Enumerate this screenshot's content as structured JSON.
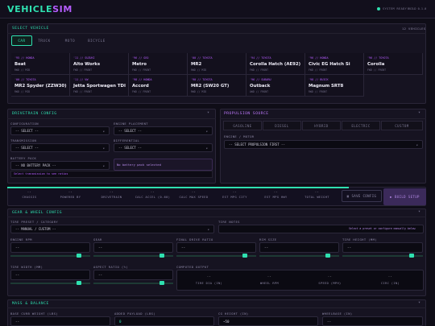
{
  "app": {
    "logo_a": "VEHICLE",
    "logo_b": "SIM",
    "status": "SYSTEM READY",
    "build": "BUILD 0.1.0"
  },
  "select_vehicle": {
    "title": "SELECT VEHICLE",
    "count": "12 VEHICLES",
    "tabs": [
      "CAR",
      "TRUCK",
      "MOTO",
      "BICYCLE"
    ],
    "active_tab": "CAR",
    "vehicles": [
      {
        "tag": "'95 // HONDA",
        "name": "Beat",
        "spec": "RWD // MID"
      },
      {
        "tag": "'11 // SUZUKI",
        "name": "Alto Works",
        "spec": "FWD // FRONT"
      },
      {
        "tag": "'96 // GEO",
        "name": "Metro",
        "spec": "FWD // FRONT"
      },
      {
        "tag": "'00 // TOYOTA",
        "name": "MR2",
        "spec": "RWD // MID"
      },
      {
        "tag": "'94 // TOYOTA",
        "name": "Corolla Hatch (AE92)",
        "spec": "FWD // FRONT"
      },
      {
        "tag": "'96 // HONDA",
        "name": "Civic EG Hatch Si",
        "spec": "FWD // FRONT"
      },
      {
        "tag": "'96 // TOYOTA",
        "name": "Corolla",
        "spec": "FWD // FRONT"
      },
      {
        "tag": "'00 // TOYOTA",
        "name": "MR2 Spyder (ZZW30)",
        "spec": "RWD // MID"
      },
      {
        "tag": "'11 // VW",
        "name": "Jetta Sportwagen TDI",
        "spec": "FWD // FRONT"
      },
      {
        "tag": "'98 // HONDA",
        "name": "Accord",
        "spec": "FWD // FRONT"
      },
      {
        "tag": "'90 // TOYOTA",
        "name": "MR2 (SW20 GT)",
        "spec": "RWD // MID"
      },
      {
        "tag": "'96 // SUBARU",
        "name": "Outback",
        "spec": "AWD // FRONT"
      },
      {
        "tag": "'98 // BUICK",
        "name": "Magnum SRT8",
        "spec": "RWD // FRONT"
      }
    ]
  },
  "drivetrain": {
    "title": "DRIVETRAIN CONFIG",
    "configuration_label": "CONFIGURATION",
    "configuration_value": "-- SELECT --",
    "engine_placement_label": "ENGINE PLACEMENT",
    "engine_placement_value": "-- SELECT --",
    "transmission_label": "TRANSMISSION",
    "transmission_value": "-- SELECT --",
    "differential_label": "DIFFERENTIAL",
    "differential_value": "-- SELECT --",
    "battery_label": "BATTERY PACK",
    "battery_value": "-- NO BATTERY PACK --",
    "battery_note": "No battery pack selected",
    "hint": "Select transmission to see ratios"
  },
  "propulsion": {
    "title": "PROPULSION SOURCE",
    "tabs": [
      "GASOLINE",
      "DIESEL",
      "HYBRID",
      "ELECTRIC",
      "CUSTOM"
    ],
    "engine_label": "ENGINE / MOTOR",
    "engine_value": "-- SELECT PROPULSION FIRST --"
  },
  "metrics": {
    "items": [
      {
        "label": "CHASSIS",
        "value": "--"
      },
      {
        "label": "POWERED BY",
        "value": "--"
      },
      {
        "label": "DRIVETRAIN",
        "value": "--"
      },
      {
        "label": "CALC ACCEL (0-60)",
        "value": "--"
      },
      {
        "label": "CALC MAX SPEED",
        "value": "--"
      },
      {
        "label": "EST MPG CITY",
        "value": "--"
      },
      {
        "label": "EST MPG HWY",
        "value": "--"
      },
      {
        "label": "TOTAL WEIGHT",
        "value": "--"
      }
    ],
    "save_label": "SAVE CONFIG",
    "build_label": "BUILD SETUP"
  },
  "gear": {
    "title": "GEAR & WHEEL CONFIG",
    "preset_label": "TIRE PRESET / CATEGORY",
    "preset_value": "-- MANUAL / CUSTOM --",
    "notes_label": "TIRE NOTES",
    "notes_value": "Select a preset or configure manually below",
    "engine_rpm_label": "ENGINE RPM",
    "gear_label": "GEAR",
    "final_drive_label": "FINAL DRIVE RATIO",
    "rim_size_label": "RIM SIZE",
    "tire_height_label": "TIRE HEIGHT (MM)",
    "tire_width_label": "TIRE WIDTH (MM)",
    "aspect_label": "ASPECT RATIO (%)",
    "computed_label": "COMPUTED OUTPUT",
    "computed": [
      {
        "label": "TIRE DIA (IN)",
        "value": "--"
      },
      {
        "label": "WHEEL RPM",
        "value": "--"
      },
      {
        "label": "SPEED (MPH)",
        "value": "--"
      },
      {
        "label": "CIRC (IN)",
        "value": "--"
      }
    ],
    "empty_value": "--"
  },
  "mass": {
    "title": "MASS & BALANCE",
    "base_curb_label": "BASE CURB WEIGHT (LBS)",
    "added_payload_label": "ADDED PAYLOAD (LBS)",
    "added_payload_value": "0",
    "cg_label": "CG HEIGHT (IN)",
    "cg_value": "~50",
    "wheelbase_label": "WHEELBASE (IN)",
    "empty_value": "--"
  }
}
